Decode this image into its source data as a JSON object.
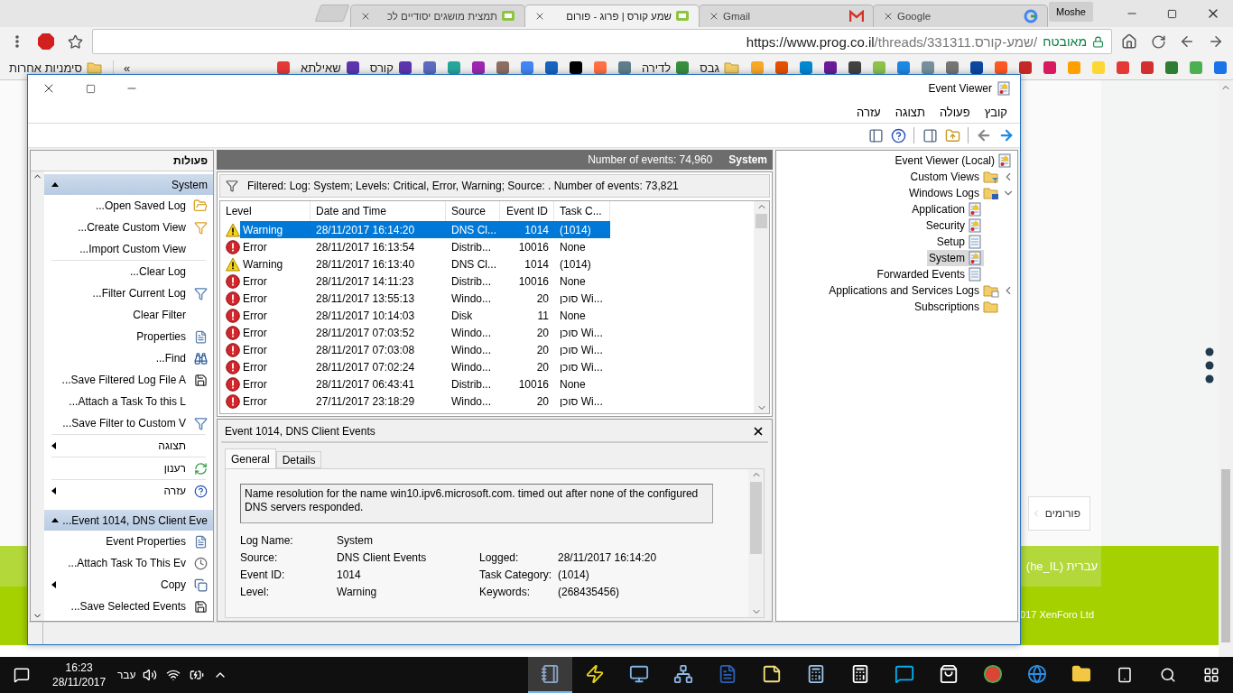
{
  "browser": {
    "tabs": [
      {
        "title": "תמצית מושגים יסודיים לכ",
        "selected": false
      },
      {
        "title": "שמע קורס | פרוג - פורום",
        "selected": true
      },
      {
        "title": "Gmail",
        "selected": false
      },
      {
        "title": "Google",
        "selected": false
      }
    ],
    "profile": "Moshe",
    "address": {
      "host": "https://www.prog.co.il",
      "path": "/threads/331311.שמע-קורס/",
      "secure_label": "מאובטח"
    },
    "bookmarks": {
      "items": [
        {
          "kind": "icon"
        },
        {
          "kind": "icon"
        },
        {
          "kind": "icon"
        },
        {
          "kind": "icon"
        },
        {
          "kind": "icon"
        },
        {
          "kind": "icon"
        },
        {
          "kind": "icon"
        },
        {
          "kind": "icon"
        },
        {
          "kind": "icon"
        },
        {
          "kind": "icon"
        },
        {
          "kind": "icon"
        },
        {
          "kind": "icon"
        },
        {
          "kind": "icon"
        },
        {
          "kind": "icon"
        },
        {
          "kind": "icon"
        },
        {
          "kind": "icon"
        },
        {
          "kind": "icon"
        },
        {
          "kind": "icon"
        },
        {
          "kind": "icon"
        },
        {
          "kind": "icon"
        },
        {
          "kind": "folder",
          "label": "גבס"
        },
        {
          "kind": "link",
          "label": "לדירה"
        },
        {
          "kind": "icon"
        },
        {
          "kind": "icon"
        },
        {
          "kind": "icon"
        },
        {
          "kind": "icon"
        },
        {
          "kind": "icon"
        },
        {
          "kind": "icon"
        },
        {
          "kind": "icon"
        },
        {
          "kind": "icon"
        },
        {
          "kind": "icon"
        },
        {
          "kind": "link",
          "label": "קורס"
        },
        {
          "kind": "link",
          "label": "שאילתא"
        },
        {
          "kind": "icon"
        }
      ],
      "more": "»",
      "other": "סימניות אחרות"
    }
  },
  "event_viewer": {
    "title": "Event Viewer",
    "menu": [
      "קובץ",
      "פעולה",
      "תצוגה",
      "עזרה"
    ],
    "tree": [
      {
        "label": "Event Viewer (Local)",
        "selected": false,
        "children": [
          {
            "label": "Custom Views",
            "selected": false,
            "expanded": false
          },
          {
            "label": "Windows Logs",
            "selected": false,
            "expanded": true,
            "children": [
              {
                "label": "Application",
                "selected": false
              },
              {
                "label": "Security",
                "selected": false
              },
              {
                "label": "Setup",
                "selected": false
              },
              {
                "label": "System",
                "selected": true
              },
              {
                "label": "Forwarded Events",
                "selected": false
              }
            ]
          },
          {
            "label": "Applications and Services Logs",
            "selected": false,
            "expanded": false
          },
          {
            "label": "Subscriptions",
            "selected": false
          }
        ]
      }
    ],
    "log_header": {
      "count": "Number of events: 74,960",
      "name": "System"
    },
    "filter": "Filtered: Log: System; Levels: Critical, Error, Warning; Source: . Number of events: 73,821",
    "columns": [
      "Level",
      "Date and Time",
      "Source",
      "Event ID",
      "Task C..."
    ],
    "events": [
      {
        "kind": "warning",
        "level": "Warning",
        "date": "28/11/2017 16:14:20",
        "source": "DNS Cl...",
        "id": "1014",
        "task": "(1014)",
        "selected": true
      },
      {
        "kind": "error",
        "level": "Error",
        "date": "28/11/2017 16:13:54",
        "source": "Distrib...",
        "id": "10016",
        "task": "None",
        "selected": false
      },
      {
        "kind": "warning",
        "level": "Warning",
        "date": "28/11/2017 16:13:40",
        "source": "DNS Cl...",
        "id": "1014",
        "task": "(1014)",
        "selected": false
      },
      {
        "kind": "error",
        "level": "Error",
        "date": "28/11/2017 14:11:23",
        "source": "Distrib...",
        "id": "10016",
        "task": "None",
        "selected": false
      },
      {
        "kind": "error",
        "level": "Error",
        "date": "28/11/2017 13:55:13",
        "source": "Windo...",
        "id": "20",
        "task": "סוכן Wi...",
        "selected": false
      },
      {
        "kind": "error",
        "level": "Error",
        "date": "28/11/2017 10:14:03",
        "source": "Disk",
        "id": "11",
        "task": "None",
        "selected": false
      },
      {
        "kind": "error",
        "level": "Error",
        "date": "28/11/2017 07:03:52",
        "source": "Windo...",
        "id": "20",
        "task": "סוכן Wi...",
        "selected": false
      },
      {
        "kind": "error",
        "level": "Error",
        "date": "28/11/2017 07:03:08",
        "source": "Windo...",
        "id": "20",
        "task": "סוכן Wi...",
        "selected": false
      },
      {
        "kind": "error",
        "level": "Error",
        "date": "28/11/2017 07:02:24",
        "source": "Windo...",
        "id": "20",
        "task": "סוכן Wi...",
        "selected": false
      },
      {
        "kind": "error",
        "level": "Error",
        "date": "28/11/2017 06:43:41",
        "source": "Distrib...",
        "id": "10016",
        "task": "None",
        "selected": false
      },
      {
        "kind": "error",
        "level": "Error",
        "date": "27/11/2017 23:18:29",
        "source": "Windo...",
        "id": "20",
        "task": "סוכן Wi...",
        "selected": false
      }
    ],
    "detail": {
      "title": "Event 1014, DNS Client Events",
      "tabs": [
        {
          "label": "General",
          "selected": true
        },
        {
          "label": "Details",
          "selected": false
        }
      ],
      "message": "Name resolution for the name win10.ipv6.microsoft.com. timed out after none of the configured DNS servers responded.",
      "fields": [
        {
          "label": "Log Name:",
          "value": "System"
        },
        {
          "label": "Source:",
          "value": "DNS Client Events",
          "label2": "Logged:",
          "value2": "28/11/2017 16:14:20"
        },
        {
          "label": "Event ID:",
          "value": "1014",
          "label2": "Task Category:",
          "value2": "(1014)"
        },
        {
          "label": "Level:",
          "value": "Warning",
          "label2": "Keywords:",
          "value2": "(268435456)"
        }
      ]
    },
    "actions": {
      "title": "פעולות",
      "sections": [
        {
          "title": "System",
          "expanded": true,
          "items": [
            {
              "kind": "action",
              "label": "Open Saved Log..."
            },
            {
              "kind": "action",
              "label": "Create Custom View..."
            },
            {
              "kind": "action",
              "label": "Import Custom View..."
            },
            {
              "kind": "separator"
            },
            {
              "kind": "action",
              "label": "Clear Log..."
            },
            {
              "kind": "action",
              "label": "Filter Current Log..."
            },
            {
              "kind": "action",
              "label": "Clear Filter"
            },
            {
              "kind": "action",
              "label": "Properties"
            },
            {
              "kind": "action",
              "label": "Find..."
            },
            {
              "kind": "action",
              "label": "Save Filtered Log File A..."
            },
            {
              "kind": "action",
              "label": "Attach a Task To this L..."
            },
            {
              "kind": "action",
              "label": "Save Filter to Custom V..."
            },
            {
              "kind": "separator"
            },
            {
              "kind": "submenu",
              "label": "תצוגה"
            },
            {
              "kind": "separator"
            },
            {
              "kind": "action",
              "label": "רענון"
            },
            {
              "kind": "separator"
            },
            {
              "kind": "submenu",
              "label": "עזרה"
            }
          ]
        },
        {
          "title": "Event 1014, DNS Client Eve...",
          "expanded": true,
          "items": [
            {
              "kind": "action",
              "label": "Event Properties"
            },
            {
              "kind": "action",
              "label": "Attach Task To This Ev..."
            },
            {
              "kind": "submenu",
              "label": "Copy"
            },
            {
              "kind": "action",
              "label": "Save Selected Events..."
            }
          ]
        }
      ]
    }
  },
  "page_behind": {
    "breadcrumb": "פורומים",
    "language": "עברית (he_IL)",
    "copyright": "017 XenForo Ltd"
  },
  "taskbar": {
    "time": "16:23",
    "date": "28/11/2017",
    "language": "עבר",
    "apps": [
      {
        "selected": true
      },
      {
        "selected": false
      },
      {
        "selected": false
      },
      {
        "selected": false
      },
      {
        "selected": false
      },
      {
        "selected": false
      },
      {
        "selected": false
      },
      {
        "selected": false
      },
      {
        "selected": false
      },
      {
        "selected": false
      },
      {
        "selected": false
      },
      {
        "selected": false
      },
      {
        "selected": false
      }
    ]
  }
}
